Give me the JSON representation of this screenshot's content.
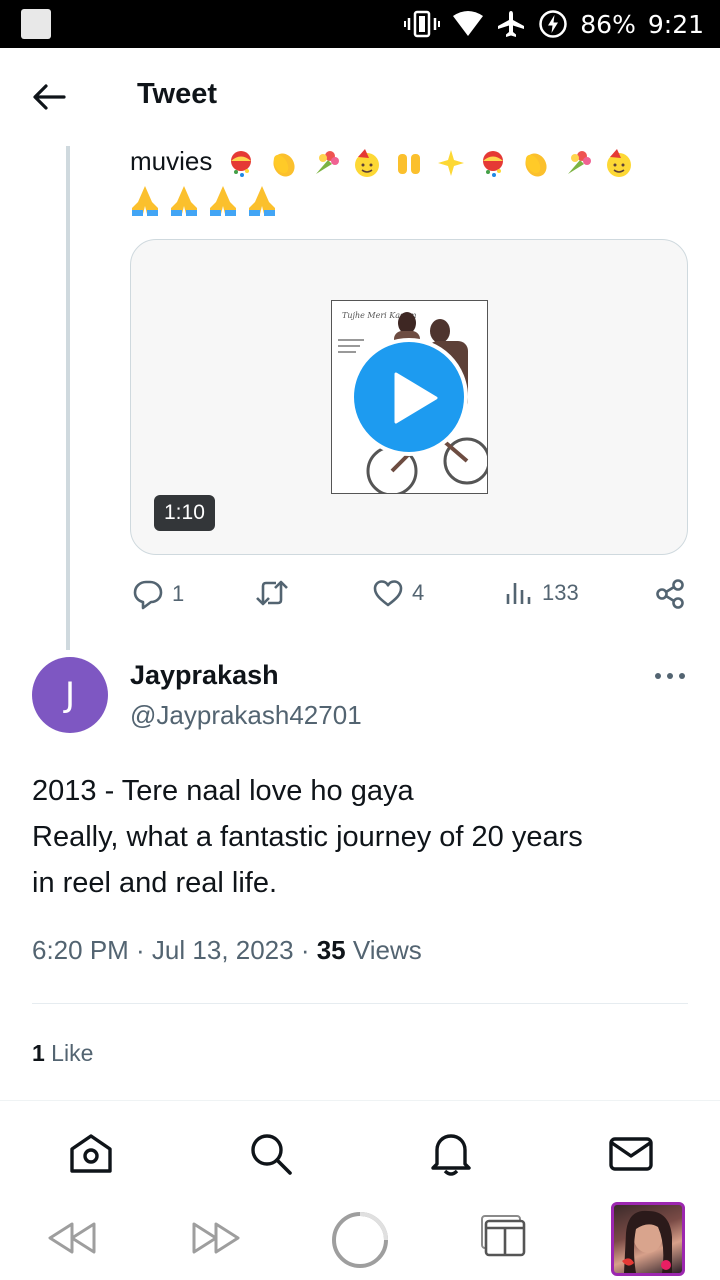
{
  "status_bar": {
    "battery_percent": "86%",
    "time": "9:21",
    "icons": [
      "notification-square-icon",
      "vibrate-icon",
      "wifi-icon",
      "airplane-icon",
      "battery-charging-icon"
    ]
  },
  "header": {
    "title": "Tweet",
    "back_icon": "back-arrow-icon"
  },
  "previous_tweet": {
    "text_visible": "muvies",
    "emojis_line1": [
      "confetti-ball",
      "clapping-hands",
      "bouquet",
      "partying-face",
      "raising-hands",
      "sparkles",
      "confetti-ball",
      "clapping-hands",
      "bouquet",
      "partying-face"
    ],
    "emojis_line2": [
      "folded-hands",
      "folded-hands",
      "folded-hands",
      "folded-hands"
    ],
    "video": {
      "duration": "1:10",
      "poster_title": "Tujhe Meri Kasam"
    },
    "actions": {
      "replies": "1",
      "retweets": "",
      "likes": "4",
      "views": "133"
    }
  },
  "tweet": {
    "avatar_letter": "J",
    "avatar_color": "#7e57c2",
    "display_name": "Jayprakash",
    "handle": "@Jayprakash42701",
    "lines": [
      "2013 - Tere naal love ho gaya",
      "Really, what a fantastic journey of 20 years",
      "in reel and real life."
    ],
    "timestamp": "6:20 PM · Jul 13, 2023 · ",
    "views_count": "35",
    "views_label": " Views",
    "likes_count": "1",
    "likes_label": " Like"
  },
  "bottom_nav": {
    "items": [
      "home-icon",
      "search-icon",
      "notifications-icon",
      "messages-icon"
    ]
  },
  "browser_toolbar": {
    "items": [
      "rewind-icon",
      "fast-forward-icon",
      "loading-circle-icon",
      "tabs-icon",
      "profile-thumbnail"
    ]
  },
  "colors": {
    "accent": "#1d9bf0",
    "text": "#0f1419",
    "secondary": "#536471",
    "border": "#cfd9de",
    "profile_border": "#9c27b0"
  }
}
